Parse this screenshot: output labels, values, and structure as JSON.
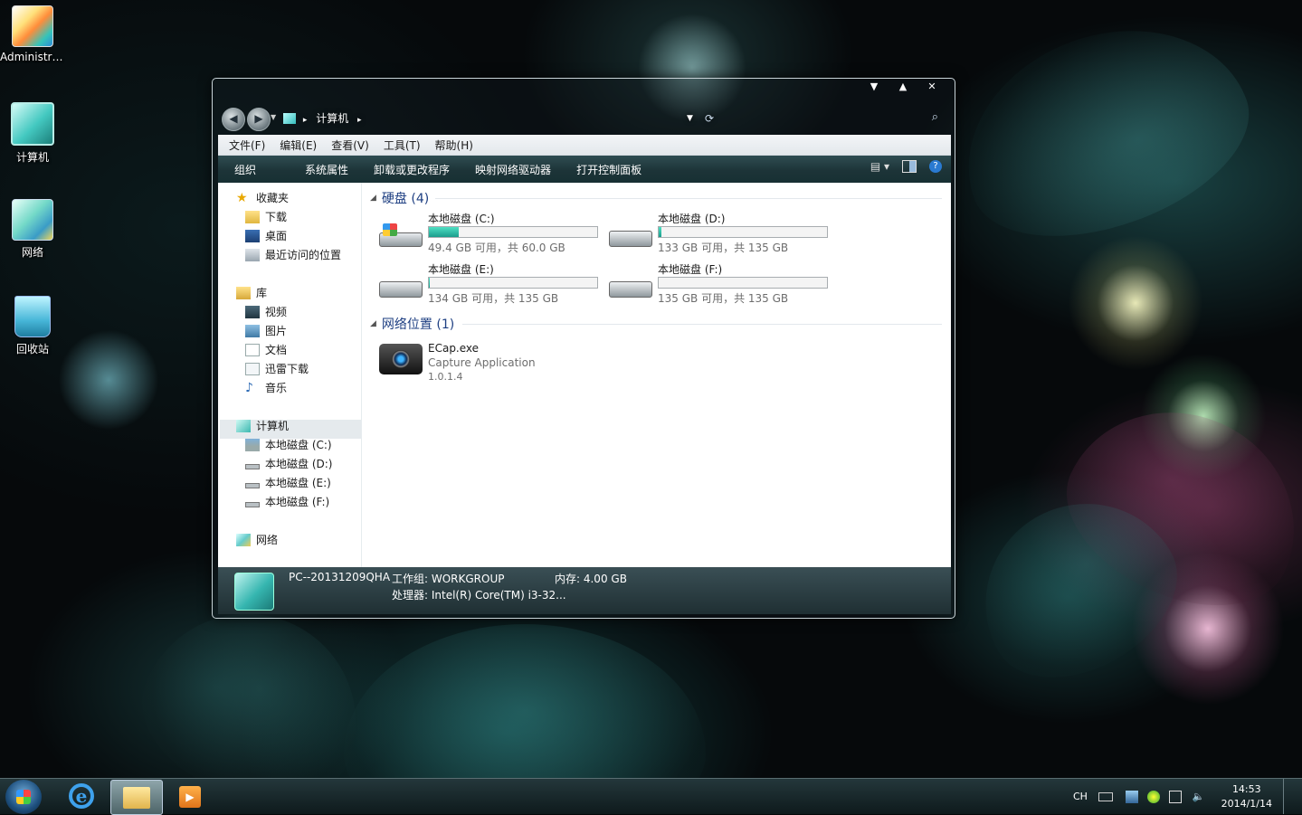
{
  "desktop": {
    "icons": [
      {
        "label": "Administra...",
        "icon": "user-folder-icon"
      },
      {
        "label": "计算机",
        "icon": "computer-icon"
      },
      {
        "label": "网络",
        "icon": "network-icon"
      },
      {
        "label": "回收站",
        "icon": "recycle-bin-icon"
      }
    ]
  },
  "window": {
    "controls": {
      "minimize": "▼",
      "maximize": "▲",
      "close": "✕"
    },
    "address": {
      "crumb": "计算机",
      "separator": "▸"
    },
    "menubar": [
      "文件(F)",
      "编辑(E)",
      "查看(V)",
      "工具(T)",
      "帮助(H)"
    ],
    "toolbar": [
      "组织",
      "系统属性",
      "卸载或更改程序",
      "映射网络驱动器",
      "打开控制面板"
    ],
    "sidebar": {
      "favorites": {
        "label": "收藏夹",
        "items": [
          "下载",
          "桌面",
          "最近访问的位置"
        ]
      },
      "libraries": {
        "label": "库",
        "items": [
          "视频",
          "图片",
          "文档",
          "迅雷下载",
          "音乐"
        ]
      },
      "computer": {
        "label": "计算机",
        "items": [
          "本地磁盘 (C:)",
          "本地磁盘 (D:)",
          "本地磁盘 (E:)",
          "本地磁盘 (F:)"
        ]
      },
      "network": {
        "label": "网络"
      }
    },
    "content": {
      "hard_disks": {
        "title": "硬盘 (4)",
        "drives": [
          {
            "name": "本地磁盘 (C:)",
            "info": "49.4 GB 可用，共 60.0 GB",
            "used_fraction": 0.18
          },
          {
            "name": "本地磁盘 (D:)",
            "info": "133 GB 可用，共 135 GB",
            "used_fraction": 0.015
          },
          {
            "name": "本地磁盘 (E:)",
            "info": "134 GB 可用，共 135 GB",
            "used_fraction": 0.007
          },
          {
            "name": "本地磁盘 (F:)",
            "info": "135 GB 可用，共 135 GB",
            "used_fraction": 0.0
          }
        ]
      },
      "network_locations": {
        "title": "网络位置 (1)",
        "item": {
          "name": "ECap.exe",
          "description": "Capture Application",
          "version": "1.0.1.4"
        }
      }
    },
    "details": {
      "pc_name": "PC--20131209QHA",
      "workgroup": "工作组: WORKGROUP",
      "memory": "内存: 4.00 GB",
      "processor": "处理器: Intel(R) Core(TM) i3-32..."
    }
  },
  "taskbar": {
    "tray": {
      "lang": "CH",
      "time": "14:53",
      "date": "2014/1/14"
    }
  }
}
